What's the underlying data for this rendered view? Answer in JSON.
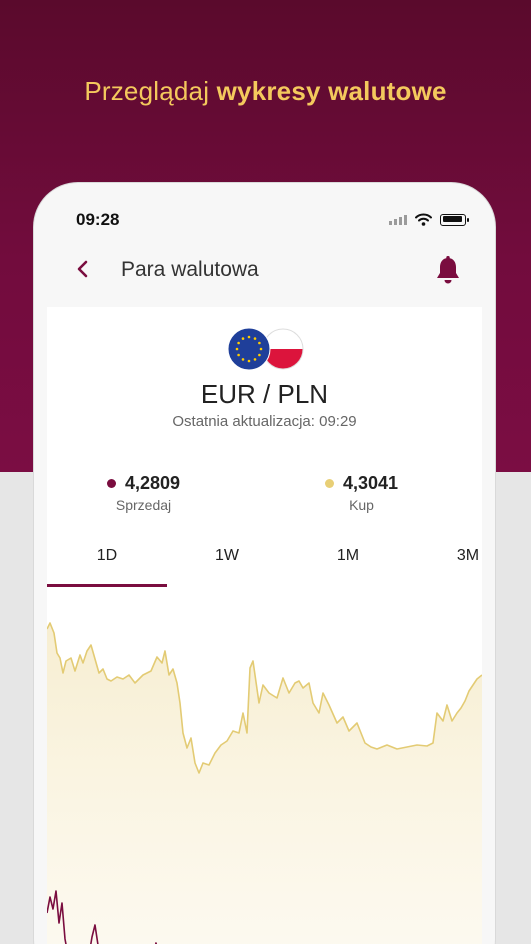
{
  "headline": {
    "normal": "Przeglądaj",
    "strong": "wykresy walutowe"
  },
  "status_bar": {
    "time": "09:28",
    "icons": [
      "signal-icon",
      "wifi-icon",
      "battery-icon"
    ]
  },
  "nav": {
    "back_icon": "chevron-left-icon",
    "title": "Para walutowa",
    "bell_icon": "bell-icon"
  },
  "pair": {
    "flags": [
      "eu-flag-icon",
      "pl-flag-icon"
    ],
    "title": "EUR / PLN",
    "last_update": "Ostatnia aktualizacja: 09:29"
  },
  "rates": {
    "sell": {
      "value": "4,2809",
      "label": "Sprzedaj",
      "color": "#7a0d3f"
    },
    "buy": {
      "value": "4,3041",
      "label": "Kup",
      "color": "#e8cf76"
    }
  },
  "tabs": [
    {
      "label": "1D",
      "selected": true
    },
    {
      "label": "1W",
      "selected": false
    },
    {
      "label": "1M",
      "selected": false
    },
    {
      "label": "3M",
      "selected": false
    }
  ],
  "colors": {
    "brand": "#7a0d3f",
    "accent": "#f4c95d",
    "buy_line": "#e8cf76",
    "sell_line": "#7a0d3f"
  }
}
